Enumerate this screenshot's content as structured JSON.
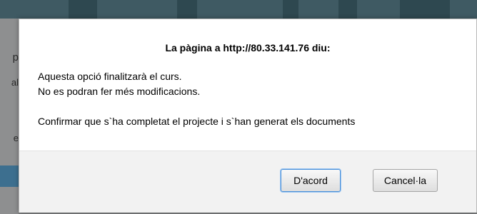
{
  "background": {
    "left_glyphs": [
      "p",
      "al",
      "e"
    ]
  },
  "dialog": {
    "title": "La pàgina a http://80.33.141.76 diu:",
    "message_lines": [
      "Aquesta opció finalitzarà el curs.",
      "No es podran fer més modificacions.",
      "",
      "Confirmar que s`ha completat el projecte i s`han generat els documents"
    ],
    "ok_label": "D'acord",
    "cancel_label": "Cancel·la"
  }
}
